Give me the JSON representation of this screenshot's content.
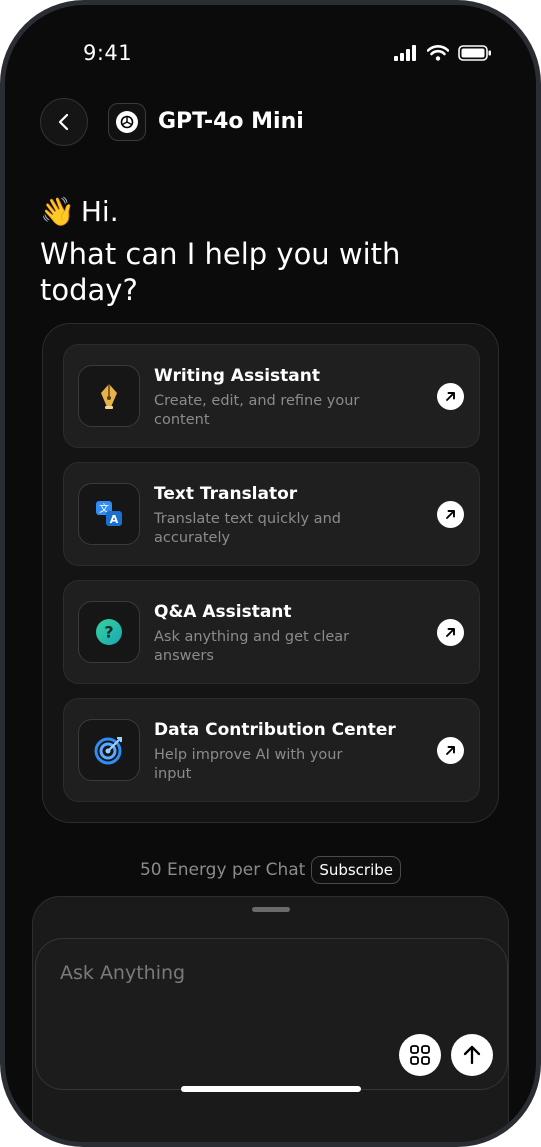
{
  "status_bar": {
    "time": "9:41"
  },
  "header": {
    "title": "GPT-4o Mini",
    "icon": "openai-logo-icon"
  },
  "greeting": {
    "emoji": "👋",
    "hi": "Hi.",
    "prompt": "What can I help you with today?"
  },
  "cards": [
    {
      "title": "Writing Assistant",
      "description": "Create, edit, and refine your content",
      "icon": "pen-nib-icon"
    },
    {
      "title": "Text Translator",
      "description": "Translate text quickly and accurately",
      "icon": "translate-icon"
    },
    {
      "title": "Q&A Assistant",
      "description": "Ask anything and get clear answers",
      "icon": "question-icon"
    },
    {
      "title": "Data Contribution Center",
      "description": "Help improve AI with your input",
      "icon": "target-icon"
    }
  ],
  "energy": {
    "text": "50 Energy per Chat",
    "subscribe_label": "Subscribe"
  },
  "composer": {
    "placeholder": "Ask Anything"
  },
  "colors": {
    "background": "#0b0b0b",
    "card": "#1f1f1f",
    "muted_text": "#8b8b8b",
    "accent_gold": "#e8b24a",
    "accent_blue": "#2f8df5",
    "accent_teal": "#1fc7a8"
  }
}
